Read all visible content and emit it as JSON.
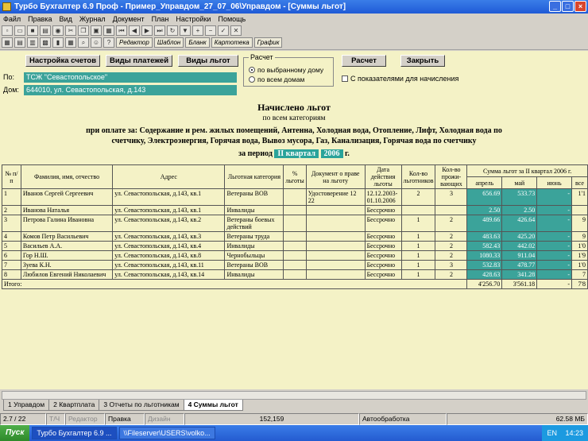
{
  "window": {
    "title": "Турбо Бухгалтер 6.9 Проф - Пример_Управдом_27_07_06\\Управдом - [Суммы льгот]"
  },
  "menu": [
    "Файл",
    "Правка",
    "Вид",
    "Журнал",
    "Документ",
    "План",
    "Настройки",
    "Помощь"
  ],
  "toolbar": {
    "tabs": [
      "Редактор",
      "Шаблон",
      "Бланк",
      "Картотека",
      "График"
    ]
  },
  "buttons": {
    "settings": "Настройка счетов",
    "payments": "Виды платежей",
    "benefits": "Виды льгот",
    "calc": "Расчет",
    "close": "Закрыть"
  },
  "calc_group": {
    "title": "Расчет",
    "option1": "по выбранному дому",
    "option2": "по всем домам",
    "selected": "по выбранному дому"
  },
  "checkbox": {
    "label": "С показателями для начисления",
    "checked": false
  },
  "fields": {
    "po_label": "По:",
    "po_value": "ТСЖ \"Севастопольское\"",
    "dom_label": "Дом:",
    "dom_value": "644010, ул. Севастопольская, д.143"
  },
  "report": {
    "title": "Начислено льгот",
    "subtitle": "по всем категориям",
    "payment_line1": "при оплате за: Содержание и рем. жилых помещений, Антенна, Холодная вода, Отопление, Лифт, Холодная вода по",
    "payment_line2": "счетчику, Электроэнергия, Горячая вода, Вывоз мусора, Газ, Канализация, Горячая вода по счетчику",
    "period_label": "за период",
    "period_quarter": "II квартал",
    "period_year": "2006",
    "period_suffix": "г."
  },
  "table": {
    "headers": {
      "num": "№ п/п",
      "name": "Фамилия, имя, отчество",
      "address": "Адрес",
      "category": "Льготная категория",
      "pct": "% льготы",
      "doc": "Документ о праве на льготу",
      "date": "Дата действия льготы",
      "count_benef": "Кол-во льготников",
      "count_res": "Кол-во прожи-вающих",
      "sum_group": "Сумма льгот за  II квартал 2006 г.",
      "april": "апрель",
      "may": "май",
      "june": "июнь",
      "total": "все"
    },
    "rows": [
      {
        "n": "1",
        "name": "Иванов Сергей Сергеевич",
        "addr": "ул. Севастопольская, д.143, кв.1",
        "cat": "Ветераны ВОВ",
        "pct": "",
        "doc": "Удостоверение 12 22",
        "date": "12.12.2003-01.10.2006",
        "cb": "2",
        "cr": "3",
        "apr": "656.69",
        "may": "533.73",
        "jun": "-",
        "tot": "1'1"
      },
      {
        "n": "2",
        "name": "Иванова Наталья",
        "addr": "ул. Севастопольская, д.143, кв.1",
        "cat": "Инвалиды",
        "pct": "",
        "doc": "",
        "date": "Бессрочно",
        "cb": "",
        "cr": "",
        "apr": "2.50",
        "may": "2.50",
        "jun": "-",
        "tot": ""
      },
      {
        "n": "3",
        "name": "Петрова Галина Ивановна",
        "addr": "ул. Севастопольская, д.143, кв.2",
        "cat": "Ветераны боевых действий",
        "pct": "",
        "doc": "",
        "date": "Бессрочно",
        "cb": "1",
        "cr": "2",
        "apr": "489.66",
        "may": "426.64",
        "jun": "-",
        "tot": "9"
      },
      {
        "n": "4",
        "name": "Комов Петр Васильевич",
        "addr": "ул. Севастопольская, д.143, кв.3",
        "cat": "Ветераны труда",
        "pct": "",
        "doc": "",
        "date": "Бессрочно",
        "cb": "1",
        "cr": "2",
        "apr": "483.63",
        "may": "425.20",
        "jun": "-",
        "tot": "9"
      },
      {
        "n": "5",
        "name": "Васильев А.А.",
        "addr": "ул. Севастопольская, д.143, кв.4",
        "cat": "Инвалиды",
        "pct": "",
        "doc": "",
        "date": "Бессрочно",
        "cb": "1",
        "cr": "2",
        "apr": "582.43",
        "may": "442.02",
        "jun": "-",
        "tot": "1'0"
      },
      {
        "n": "6",
        "name": "Гор Н.Ш.",
        "addr": "ул. Севастопольская, д.143, кв.8",
        "cat": "Чернобыльцы",
        "pct": "",
        "doc": "",
        "date": "Бессрочно",
        "cb": "1",
        "cr": "2",
        "apr": "1080.33",
        "may": "911.04",
        "jun": "-",
        "tot": "1'9"
      },
      {
        "n": "7",
        "name": "Зуева К.Н.",
        "addr": "ул. Севастопольская, д.143, кв.11",
        "cat": "Ветераны ВОВ",
        "pct": "",
        "doc": "",
        "date": "Бессрочно",
        "cb": "1",
        "cr": "3",
        "apr": "532.83",
        "may": "478.77",
        "jun": "-",
        "tot": "1'0"
      },
      {
        "n": "8",
        "name": "Любилов Евгений Николаевич",
        "addr": "ул. Севастопольская, д.143, кв.14",
        "cat": "Инвалиды",
        "pct": "",
        "doc": "",
        "date": "Бессрочно",
        "cb": "1",
        "cr": "2",
        "apr": "428.63",
        "may": "341.28",
        "jun": "-",
        "tot": "7"
      }
    ],
    "total_row": {
      "label": "Итого:",
      "apr": "4'256.70",
      "may": "3'561.18",
      "jun": "-",
      "tot": "7'8"
    }
  },
  "sheet_tabs": [
    "1 Управдом",
    "2 Квартплата",
    "3 Отчеты по льготникам",
    "4 Суммы льгот"
  ],
  "status": {
    "page": "2.7 / 22",
    "tc": "Т/Ч",
    "editor": "Редактор",
    "edit": "Правка",
    "design": "Дизайн",
    "coords": "152,159",
    "auto": "Автообработка",
    "mem": "62.58 МБ"
  },
  "taskbar": {
    "start": "Пуск",
    "task1": "Турбо Бухгалтер 6.9 ...",
    "task2": "\\\\Fileserver\\USERS\\volko...",
    "lang": "EN",
    "time": "14:23"
  },
  "colors": {
    "accent_teal": "#3ba39a",
    "doc_bg": "#f4f2c6",
    "title_blue": "#245bd0"
  }
}
